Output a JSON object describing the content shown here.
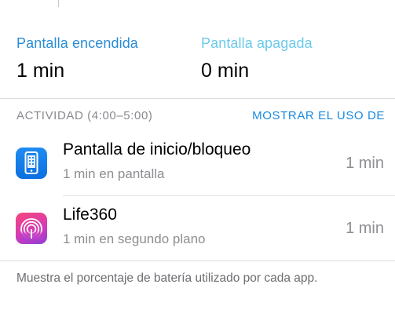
{
  "screen_usage": {
    "on_label": "Pantalla encendida",
    "on_value": "1 min",
    "off_label": "Pantalla apagada",
    "off_value": "0 min"
  },
  "activity": {
    "title": "ACTIVIDAD (4:00–5:00)",
    "action": "MOSTRAR EL USO DE"
  },
  "apps": [
    {
      "name": "Pantalla de inicio/bloqueo",
      "detail": "1 min en pantalla",
      "time": "1 min",
      "icon": "phone-screen-icon"
    },
    {
      "name": "Life360",
      "detail": "1 min en segundo plano",
      "time": "1 min",
      "icon": "life360-icon"
    }
  ],
  "footer": {
    "note": "Muestra el porcentaje de batería utilizado por cada app."
  },
  "colors": {
    "screen_on": "#2a8cd6",
    "screen_off": "#6cc9ea",
    "action_link": "#1a8ae0",
    "home_icon_bg": "#1f8cf2",
    "life360_icon_bg": "#e0409a"
  }
}
